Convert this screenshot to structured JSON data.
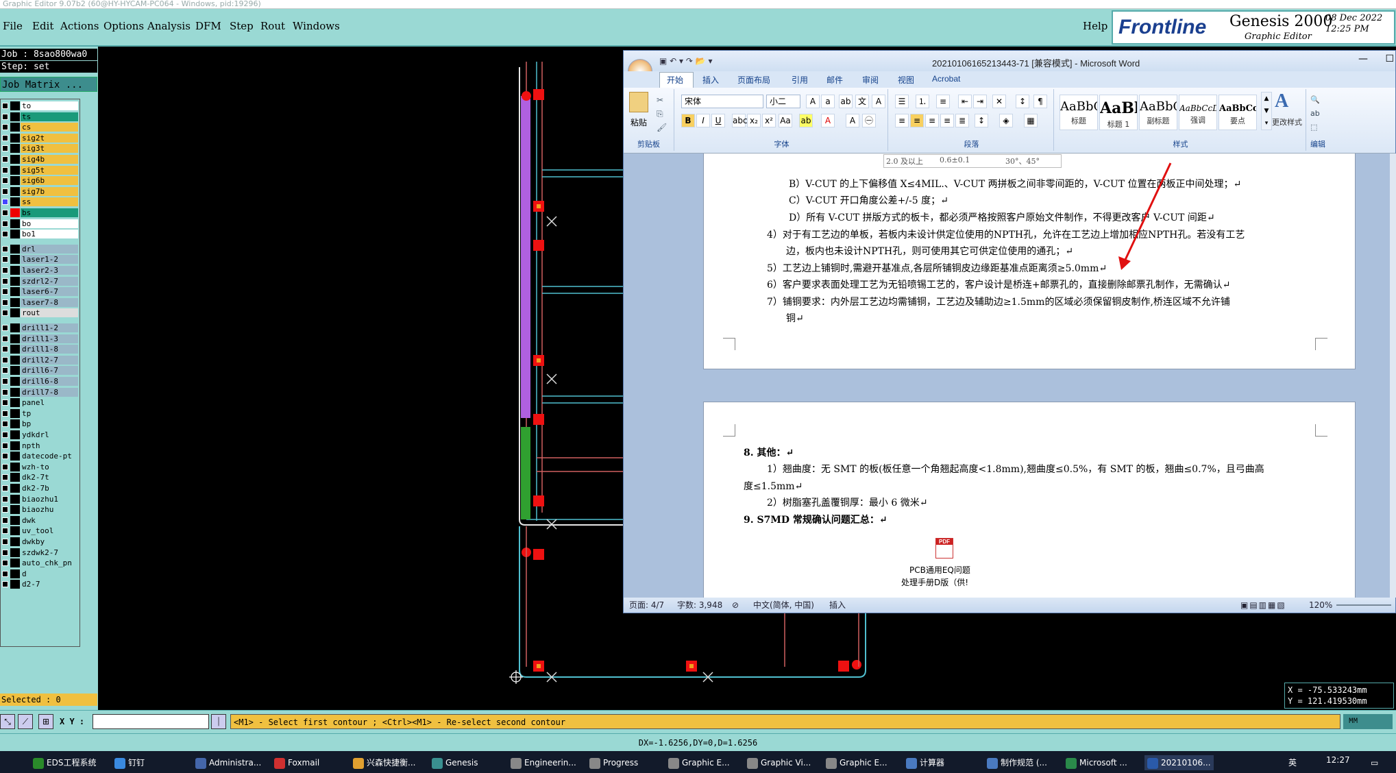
{
  "window_title": "Graphic Editor 9.07b2 (60@HY-HYCAM-PC064 - Windows, pid:19296)",
  "menu": [
    "File",
    "Edit",
    "Actions",
    "Options",
    "Analysis",
    "DFM",
    "Step",
    "Rout",
    "Windows"
  ],
  "help": "Help",
  "brand": {
    "name": "Frontline",
    "product": "Genesis 2000",
    "module": "Graphic Editor",
    "date": "08 Dec 2022",
    "time": "12:25 PM"
  },
  "left_panel": {
    "job": "Job : 8sao800wa0",
    "step": "Step: set",
    "job_matrix": "Job Matrix ...",
    "selected": "Selected : 0",
    "layers": [
      {
        "name": "to",
        "color": "#ffffff"
      },
      {
        "name": "ts",
        "color": "#1a9a7a"
      },
      {
        "name": "cs",
        "color": "#f0c040"
      },
      {
        "name": "sig2t",
        "color": "#f0c040"
      },
      {
        "name": "sig3t",
        "color": "#f0c040"
      },
      {
        "name": "sig4b",
        "color": "#f0c040"
      },
      {
        "name": "sig5t",
        "color": "#f0c040"
      },
      {
        "name": "sig6b",
        "color": "#f0c040"
      },
      {
        "name": "sig7b",
        "color": "#f0c040"
      },
      {
        "name": "ss",
        "color": "#f0c040"
      },
      {
        "name": "bs",
        "color": "#1a9a7a"
      },
      {
        "name": "bo",
        "color": "#ffffff"
      },
      {
        "name": "bo1",
        "color": "#ffffff"
      },
      {
        "name": "drl",
        "color": "#9ab8c8"
      },
      {
        "name": "laser1-2",
        "color": "#9ab8c8"
      },
      {
        "name": "laser2-3",
        "color": "#9ab8c8"
      },
      {
        "name": "szdrl2-7",
        "color": "#9ab8c8"
      },
      {
        "name": "laser6-7",
        "color": "#9ab8c8"
      },
      {
        "name": "laser7-8",
        "color": "#9ab8c8"
      },
      {
        "name": "rout",
        "color": "#dddddd"
      },
      {
        "name": "drill1-2",
        "color": "#9ab8c8"
      },
      {
        "name": "drill1-3",
        "color": "#9ab8c8"
      },
      {
        "name": "drill1-8",
        "color": "#9ab8c8"
      },
      {
        "name": "drill2-7",
        "color": "#9ab8c8"
      },
      {
        "name": "drill6-7",
        "color": "#9ab8c8"
      },
      {
        "name": "drill6-8",
        "color": "#9ab8c8"
      },
      {
        "name": "drill7-8",
        "color": "#9ab8c8"
      },
      {
        "name": "panel",
        "color": "#9ad9d4"
      },
      {
        "name": "tp",
        "color": "#9ad9d4"
      },
      {
        "name": "bp",
        "color": "#9ad9d4"
      },
      {
        "name": "ydkdrl",
        "color": "#9ad9d4"
      },
      {
        "name": "npth",
        "color": "#9ad9d4"
      },
      {
        "name": "datecode-pt",
        "color": "#9ad9d4"
      },
      {
        "name": "wzh-to",
        "color": "#9ad9d4"
      },
      {
        "name": "dk2-7t",
        "color": "#9ad9d4"
      },
      {
        "name": "dk2-7b",
        "color": "#9ad9d4"
      },
      {
        "name": "biaozhu1",
        "color": "#9ad9d4"
      },
      {
        "name": "biaozhu",
        "color": "#9ad9d4"
      },
      {
        "name": "dwk",
        "color": "#9ad9d4"
      },
      {
        "name": "uv_tool",
        "color": "#9ad9d4"
      },
      {
        "name": "dwkby",
        "color": "#9ad9d4"
      },
      {
        "name": "szdwk2-7",
        "color": "#9ad9d4"
      },
      {
        "name": "auto_chk_pn",
        "color": "#9ad9d4"
      },
      {
        "name": "d",
        "color": "#9ad9d4"
      },
      {
        "name": "d2-7",
        "color": "#9ad9d4"
      }
    ]
  },
  "coords": {
    "x": "X = -75.533243mm",
    "y": "Y = 121.419530mm"
  },
  "cmd": {
    "xy_label": "X Y :",
    "prompt": "<M1> - Select first contour ; <Ctrl><M1> - Re-select second contour",
    "units": "MM"
  },
  "status_line": "DX=-1.6256,DY=0,D=1.6256",
  "word": {
    "title": "20210106165213443-71 [兼容模式] - Microsoft Word",
    "tabs": [
      "开始",
      "插入",
      "页面布局",
      "引用",
      "邮件",
      "审阅",
      "视图",
      "Acrobat"
    ],
    "font_name": "宋体",
    "font_size": "小二",
    "groups": [
      "剪贴板",
      "字体",
      "段落",
      "样式",
      "编辑"
    ],
    "paste": "粘贴",
    "change_styles": "更改样式",
    "styles": [
      {
        "sample": "AaBbC",
        "label": "标题"
      },
      {
        "sample": "AaBl",
        "label": "标题 1"
      },
      {
        "sample": "AaBbC",
        "label": "副标题"
      },
      {
        "sample": "AaBbCcDc",
        "label": "强调"
      },
      {
        "sample": "AaBbCcD",
        "label": "要点"
      }
    ],
    "table_row": [
      "2.0 及以上",
      "0.6±0.1",
      "30°、45°"
    ],
    "lines": [
      "B）V-CUT 的上下偏移值 X≤4MIL.、V-CUT 两拼板之间非零间距的，V-CUT 位置在两板正中间处理；↵",
      "C）V-CUT 开口角度公差+/-5 度；↵",
      "D）所有 V-CUT 拼版方式的板卡，都必须严格按照客户原始文件制作，不得更改客户 V-CUT 间距↵",
      "4）对于有工艺边的单板，若板内未设计供定位使用的NPTH孔，允许在工艺边上增加相应NPTH孔。若没有工艺",
      "边，板内也未设计NPTH孔，则可使用其它可供定位使用的通孔；↵",
      "5）工艺边上铺铜时,需避开基准点,各层所铺铜皮边缘距基准点距离须≥5.0mm↵",
      "6）客户要求表面处理工艺为无铅喷锡工艺的，客户设计是桥连+邮票孔的，直接删除邮票孔制作，无需确认↵",
      "7）铺铜要求：内外层工艺边均需铺铜，工艺边及辅助边≥1.5mm的区域必须保留铜皮制作,桥连区域不允许铺",
      "铜↵"
    ],
    "page2": [
      "8.   其他：↵",
      "1）翘曲度：无 SMT 的板(板任意一个角翘起高度<1.8mm),翘曲度≤0.5%，有 SMT 的板，翘曲≤0.7%，且弓曲高",
      "度≤1.5mm↵",
      "2）树脂塞孔盖覆铜厚：最小 6 微米↵",
      "9.   S7MD 常规确认问题汇总：↵"
    ],
    "attachment": [
      "PCB通用EQ问题",
      "处理手册D版（供!"
    ],
    "status": {
      "page": "页面: 4/7",
      "words": "字数: 3,948",
      "lang": "中文(简体, 中国)",
      "mode": "插入",
      "zoom": "120%"
    }
  },
  "taskbar": {
    "items": [
      "EDS工程系统",
      "钉钉",
      "Administra...",
      "Foxmail",
      "兴森快捷衡...",
      "Genesis",
      "Engineerin...",
      "Progress",
      "Graphic E...",
      "Graphic Vi...",
      "Graphic E...",
      "计算器",
      "制作规范 (...",
      "Microsoft ...",
      "20210106..."
    ],
    "ime": "英",
    "time": "12:27"
  }
}
